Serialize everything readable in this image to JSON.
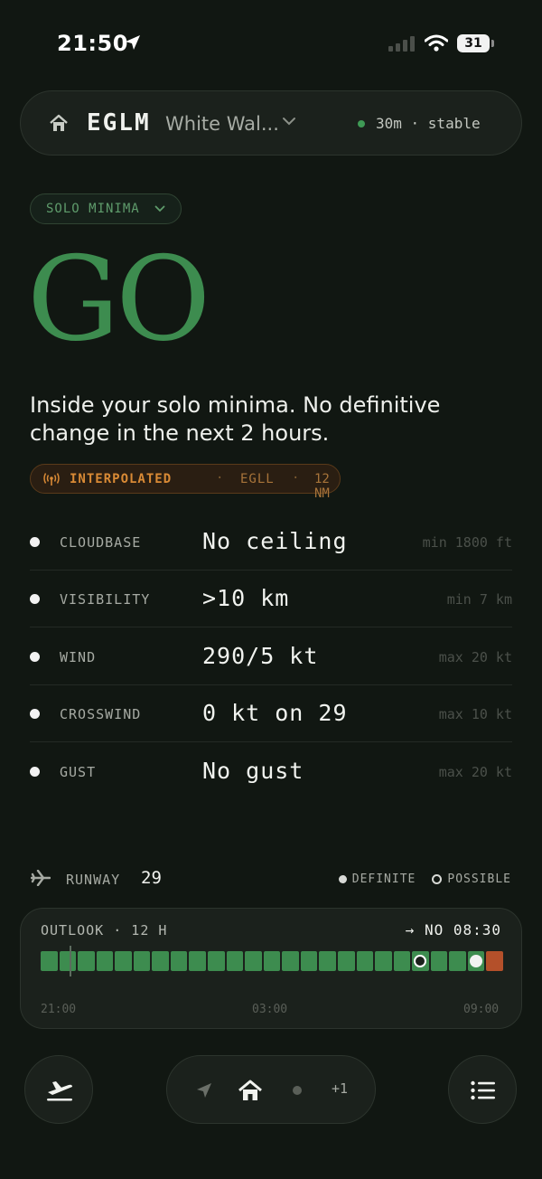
{
  "status_bar": {
    "time": "21:50",
    "battery": "31"
  },
  "station": {
    "icao": "EGLM",
    "name": "White Wal...",
    "age": "30m · stable"
  },
  "minima": {
    "label": "SOLO MINIMA"
  },
  "verdict": {
    "word": "GO",
    "summary": "Inside your solo minima. No definitive change in the next 2 hours."
  },
  "source": {
    "mode": "INTERPOLATED",
    "separator": "·",
    "station": "EGLL",
    "distance": "12 NM"
  },
  "conditions": [
    {
      "key": "CLOUDBASE",
      "value": "No ceiling",
      "limit": "min 1800 ft"
    },
    {
      "key": "VISIBILITY",
      "value": ">10 km",
      "limit": "min 7 km"
    },
    {
      "key": "WIND",
      "value": "290/5 kt",
      "limit": "max 20 kt"
    },
    {
      "key": "CROSSWIND",
      "value": "0 kt on 29",
      "limit": "max 10 kt"
    },
    {
      "key": "GUST",
      "value": "No gust",
      "limit": "max 20 kt"
    }
  ],
  "runway": {
    "label": "RUNWAY",
    "number": "29",
    "legend_definite": "DEFINITE",
    "legend_possible": "POSSIBLE"
  },
  "outlook": {
    "title": "OUTLOOK · 12 H",
    "next_change": "→ NO 08:30",
    "time_labels": [
      "21:00",
      "03:00",
      "09:00"
    ],
    "segments": [
      "go",
      "go",
      "go",
      "go",
      "go",
      "go",
      "go",
      "go",
      "go",
      "go",
      "go",
      "go",
      "go",
      "go",
      "go",
      "go",
      "go",
      "go",
      "go",
      "go",
      "go",
      "go",
      "go",
      "go",
      "no"
    ],
    "markers": [
      {
        "kind": "possible",
        "segment": 20
      },
      {
        "kind": "definite",
        "segment": 23
      }
    ],
    "now_segment": 1
  },
  "nav": {
    "pager_more": "+1"
  },
  "colors": {
    "go": "#3d8c4f",
    "no": "#b4502a",
    "interpolated": "#d98a35"
  }
}
